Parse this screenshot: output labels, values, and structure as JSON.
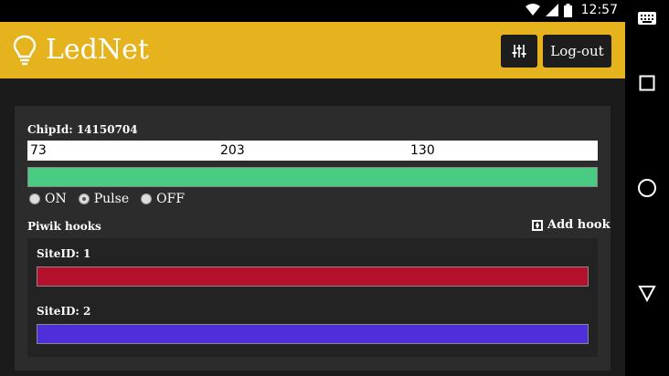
{
  "status": {
    "time": "12:57",
    "icons": [
      "wifi-icon",
      "signal-icon",
      "battery-icon"
    ]
  },
  "navbar": {
    "buttons": [
      "keyboard-icon",
      "recent-apps-icon",
      "home-icon",
      "back-icon"
    ]
  },
  "app": {
    "title": "LedNet",
    "logout_label": "Log-out",
    "settings_icon": "sliders-icon"
  },
  "device": {
    "chip_label": "ChipId: 14150704",
    "rgb": {
      "r": "73",
      "g": "203",
      "b": "130"
    },
    "color": "#49cb82",
    "modes": [
      {
        "label": "ON",
        "checked": false
      },
      {
        "label": "Pulse",
        "checked": true
      },
      {
        "label": "OFF",
        "checked": false
      }
    ]
  },
  "hooks": {
    "title": "Piwik hooks",
    "add_label": "Add hook",
    "items": [
      {
        "label": "SiteID: 1",
        "color": "#b5102c"
      },
      {
        "label": "SiteID: 2",
        "color": "#4f2fd9"
      }
    ]
  }
}
